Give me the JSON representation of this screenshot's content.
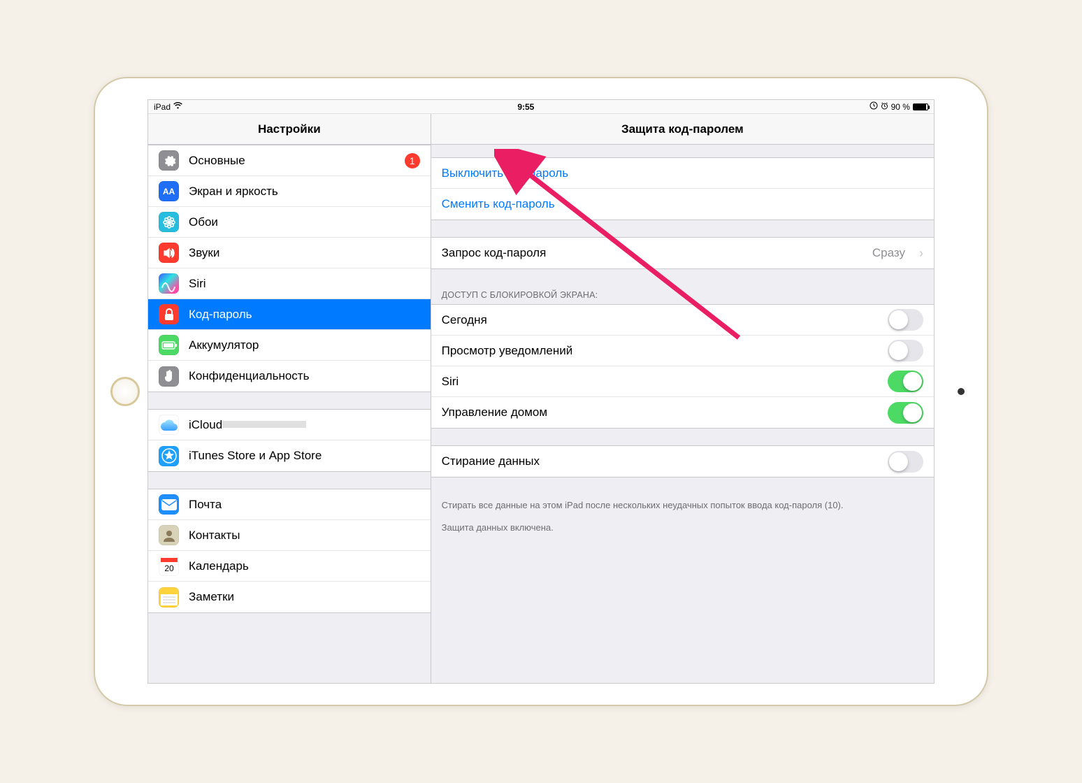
{
  "statusbar": {
    "device": "iPad",
    "time": "9:55",
    "battery": "90 %"
  },
  "sidebar": {
    "title": "Настройки",
    "groups": [
      [
        {
          "id": "general",
          "label": "Основные",
          "badge": "1",
          "icon": "gear",
          "bg": "#8e8e93"
        },
        {
          "id": "display",
          "label": "Экран и яркость",
          "icon": "AA",
          "bg": "#1f6ff6",
          "text": true
        },
        {
          "id": "wallpaper",
          "label": "Обои",
          "icon": "flower",
          "bg": "#27bdde"
        },
        {
          "id": "sounds",
          "label": "Звуки",
          "icon": "speaker",
          "bg": "#ff3b30"
        },
        {
          "id": "siri",
          "label": "Siri",
          "icon": "siri",
          "bg": "siri"
        },
        {
          "id": "passcode",
          "label": "Код-пароль",
          "icon": "lock",
          "bg": "#ff3b30",
          "selected": true
        },
        {
          "id": "battery",
          "label": "Аккумулятор",
          "icon": "battery",
          "bg": "#4cd964"
        },
        {
          "id": "privacy",
          "label": "Конфиденциальность",
          "icon": "hand",
          "bg": "#8e8e93"
        }
      ],
      [
        {
          "id": "icloud",
          "label": "iCloud",
          "sub": "",
          "icon": "cloud",
          "bg": "#fff"
        },
        {
          "id": "itunes",
          "label": "iTunes Store и App Store",
          "icon": "appstore",
          "bg": "#1ea0ff"
        }
      ],
      [
        {
          "id": "mail",
          "label": "Почта",
          "icon": "mail",
          "bg": "#1f8fff"
        },
        {
          "id": "contacts",
          "label": "Контакты",
          "icon": "contacts",
          "bg": "#d8d2b8"
        },
        {
          "id": "calendar",
          "label": "Календарь",
          "icon": "calendar",
          "bg": "#fff"
        },
        {
          "id": "notes",
          "label": "Заметки",
          "icon": "notes",
          "bg": "#ffd33b"
        }
      ]
    ]
  },
  "detail": {
    "title": "Защита код-паролем",
    "disable_label": "Выключить код-пароль",
    "change_label": "Сменить код-пароль",
    "require": {
      "label": "Запрос код-пароля",
      "value": "Сразу"
    },
    "lock_header": "ДОСТУП С БЛОКИРОВКОЙ ЭКРАНА:",
    "toggles": [
      {
        "id": "today",
        "label": "Сегодня",
        "on": false
      },
      {
        "id": "notif",
        "label": "Просмотр уведомлений",
        "on": false
      },
      {
        "id": "siri",
        "label": "Siri",
        "on": true
      },
      {
        "id": "home",
        "label": "Управление домом",
        "on": true
      }
    ],
    "erase": {
      "label": "Стирание данных",
      "on": false
    },
    "erase_footer": "Стирать все данные на этом iPad после нескольких неудачных попыток ввода код-пароля (10).",
    "protection_footer": "Защита данных включена."
  }
}
